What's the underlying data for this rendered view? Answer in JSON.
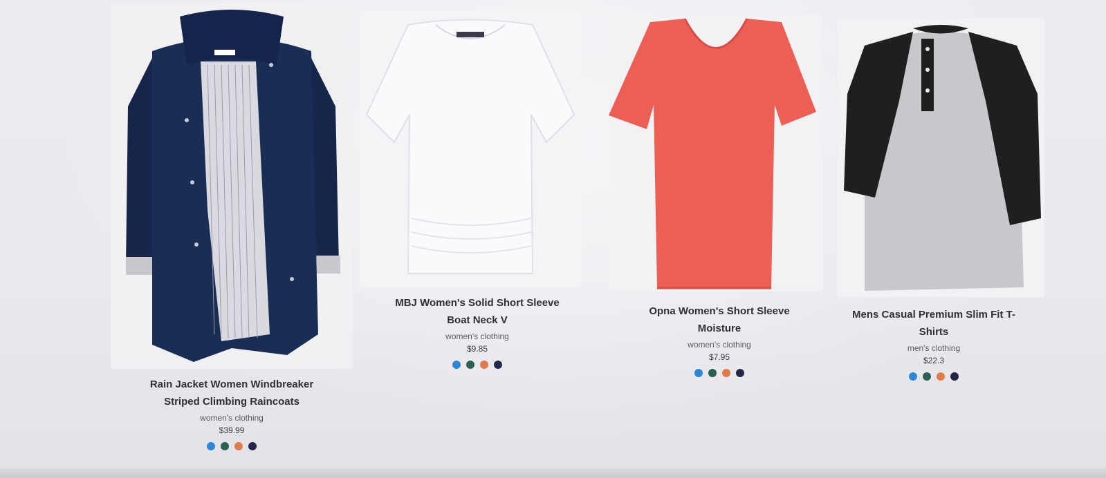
{
  "products": [
    {
      "title_line1": "Rain Jacket Women Windbreaker",
      "title_line2": "Striped Climbing Raincoats",
      "category": "women's clothing",
      "price": "$39.99",
      "image": "navy-raincoat"
    },
    {
      "title_line1": "MBJ Women's Solid Short Sleeve",
      "title_line2": "Boat Neck V",
      "category": "women's clothing",
      "price": "$9.85",
      "image": "white-boat-neck-top"
    },
    {
      "title_line1": "Opna Women's Short Sleeve",
      "title_line2": "Moisture",
      "category": "women's clothing",
      "price": "$7.95",
      "image": "red-v-neck-tshirt"
    },
    {
      "title_line1": "Mens Casual Premium Slim Fit T-",
      "title_line2": "Shirts",
      "category": "men's clothing",
      "price": "$22.3",
      "image": "grey-black-raglan-henley"
    }
  ],
  "swatch_colors": [
    "#2f86d6",
    "#2e5f55",
    "#e07a4a",
    "#252545"
  ]
}
